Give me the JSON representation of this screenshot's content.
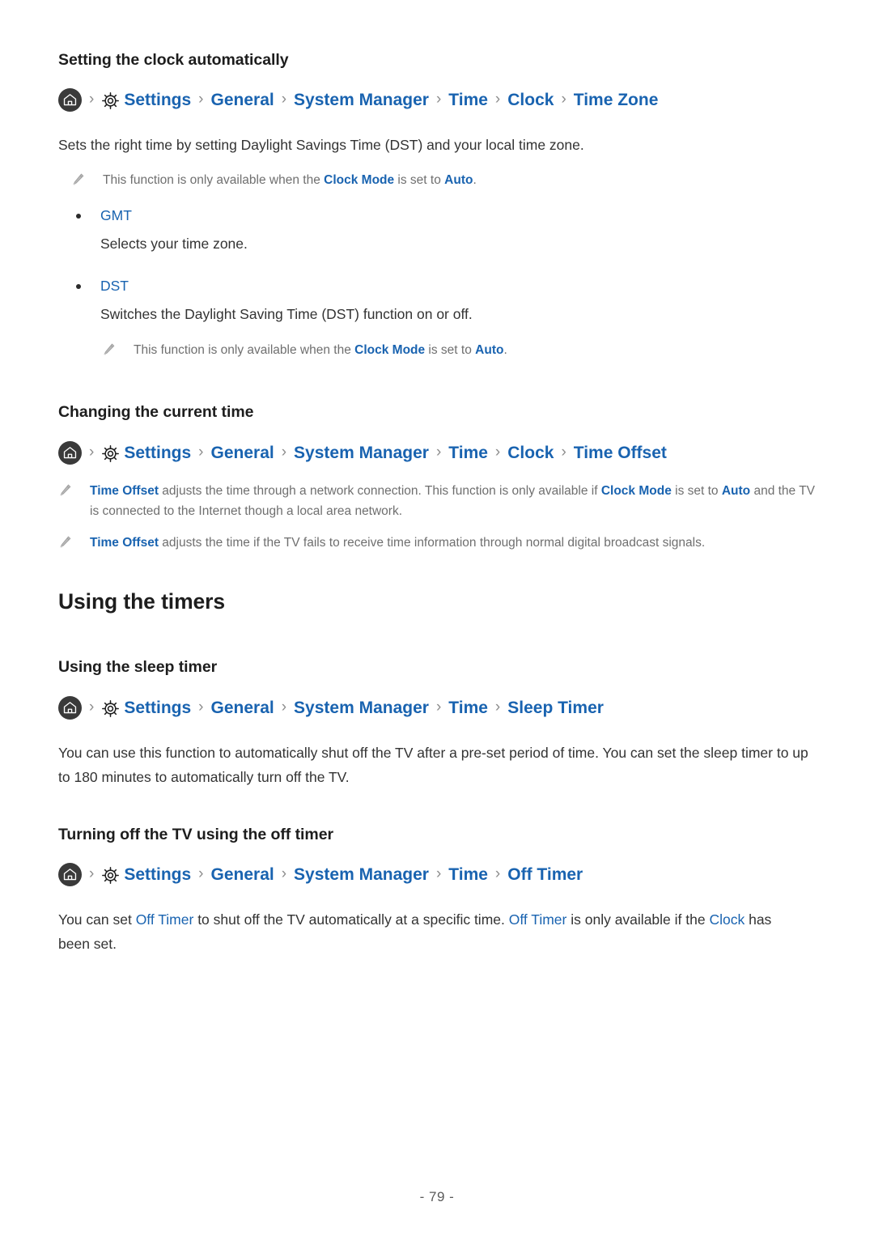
{
  "document": {
    "page_number": "- 79 -",
    "accent_color": "#1963b0",
    "text_color": "#333333",
    "note_color": "#6f6f6f"
  },
  "sections": {
    "clock_auto": {
      "title": "Setting the clock automatically",
      "breadcrumb": {
        "home_icon": "home-icon",
        "gear_icon": "gear-icon",
        "separator": "›",
        "crumbs": [
          "Settings",
          "General",
          "System Manager",
          "Time",
          "Clock",
          "Time Zone"
        ]
      },
      "description": "Sets the right time by setting Daylight Savings Time (DST) and your local time zone.",
      "note": {
        "icon": "pencil-icon",
        "part1": "This function is only available when the ",
        "link1": "Clock Mode",
        "part2": " is set to ",
        "link2": "Auto",
        "part3": "."
      },
      "options": [
        {
          "label": "GMT",
          "description": "Selects your time zone."
        },
        {
          "label": "DST",
          "description": "Switches the Daylight Saving Time (DST) function on or off."
        }
      ],
      "dst_note": {
        "icon": "pencil-icon",
        "part1": "This function is only available when the ",
        "link1": "Clock Mode",
        "part2": " is set to ",
        "link2": "Auto",
        "part3": "."
      }
    },
    "current_time": {
      "title": "Changing the current time",
      "breadcrumb": {
        "home_icon": "home-icon",
        "gear_icon": "gear-icon",
        "separator": "›",
        "crumbs": [
          "Settings",
          "General",
          "System Manager",
          "Time",
          "Clock",
          "Time Offset"
        ]
      },
      "note1": {
        "icon": "pencil-icon",
        "link1": "Time Offset",
        "part1": " adjusts the time through a network connection. This function is only available if ",
        "link2": "Clock Mode",
        "part2": " is set to ",
        "link3": "Auto",
        "part3": " and the TV is connected to the Internet though a local area network."
      },
      "note2": {
        "icon": "pencil-icon",
        "link1": "Time Offset",
        "part1": " adjusts the time if the TV fails to receive time information through normal digital broadcast signals."
      }
    },
    "timers": {
      "heading": "Using the timers",
      "sleep": {
        "title": "Using the sleep timer",
        "breadcrumb": {
          "home_icon": "home-icon",
          "gear_icon": "gear-icon",
          "separator": "›",
          "crumbs": [
            "Settings",
            "General",
            "System Manager",
            "Time",
            "Sleep Timer"
          ]
        },
        "description": "You can use this function to automatically shut off the TV after a pre-set period of time. You can set the sleep timer to up to 180 minutes to automatically turn off the TV."
      },
      "off": {
        "title": "Turning off the TV using the off timer",
        "breadcrumb": {
          "home_icon": "home-icon",
          "gear_icon": "gear-icon",
          "separator": "›",
          "crumbs": [
            "Settings",
            "General",
            "System Manager",
            "Time",
            "Off Timer"
          ]
        },
        "description": {
          "part1": "You can set ",
          "link1": "Off Timer",
          "part2": " to shut off the TV automatically at a specific time. ",
          "link2": "Off Timer",
          "part3": " is only available if the ",
          "link3": "Clock",
          "part4": " has been set."
        }
      }
    }
  }
}
